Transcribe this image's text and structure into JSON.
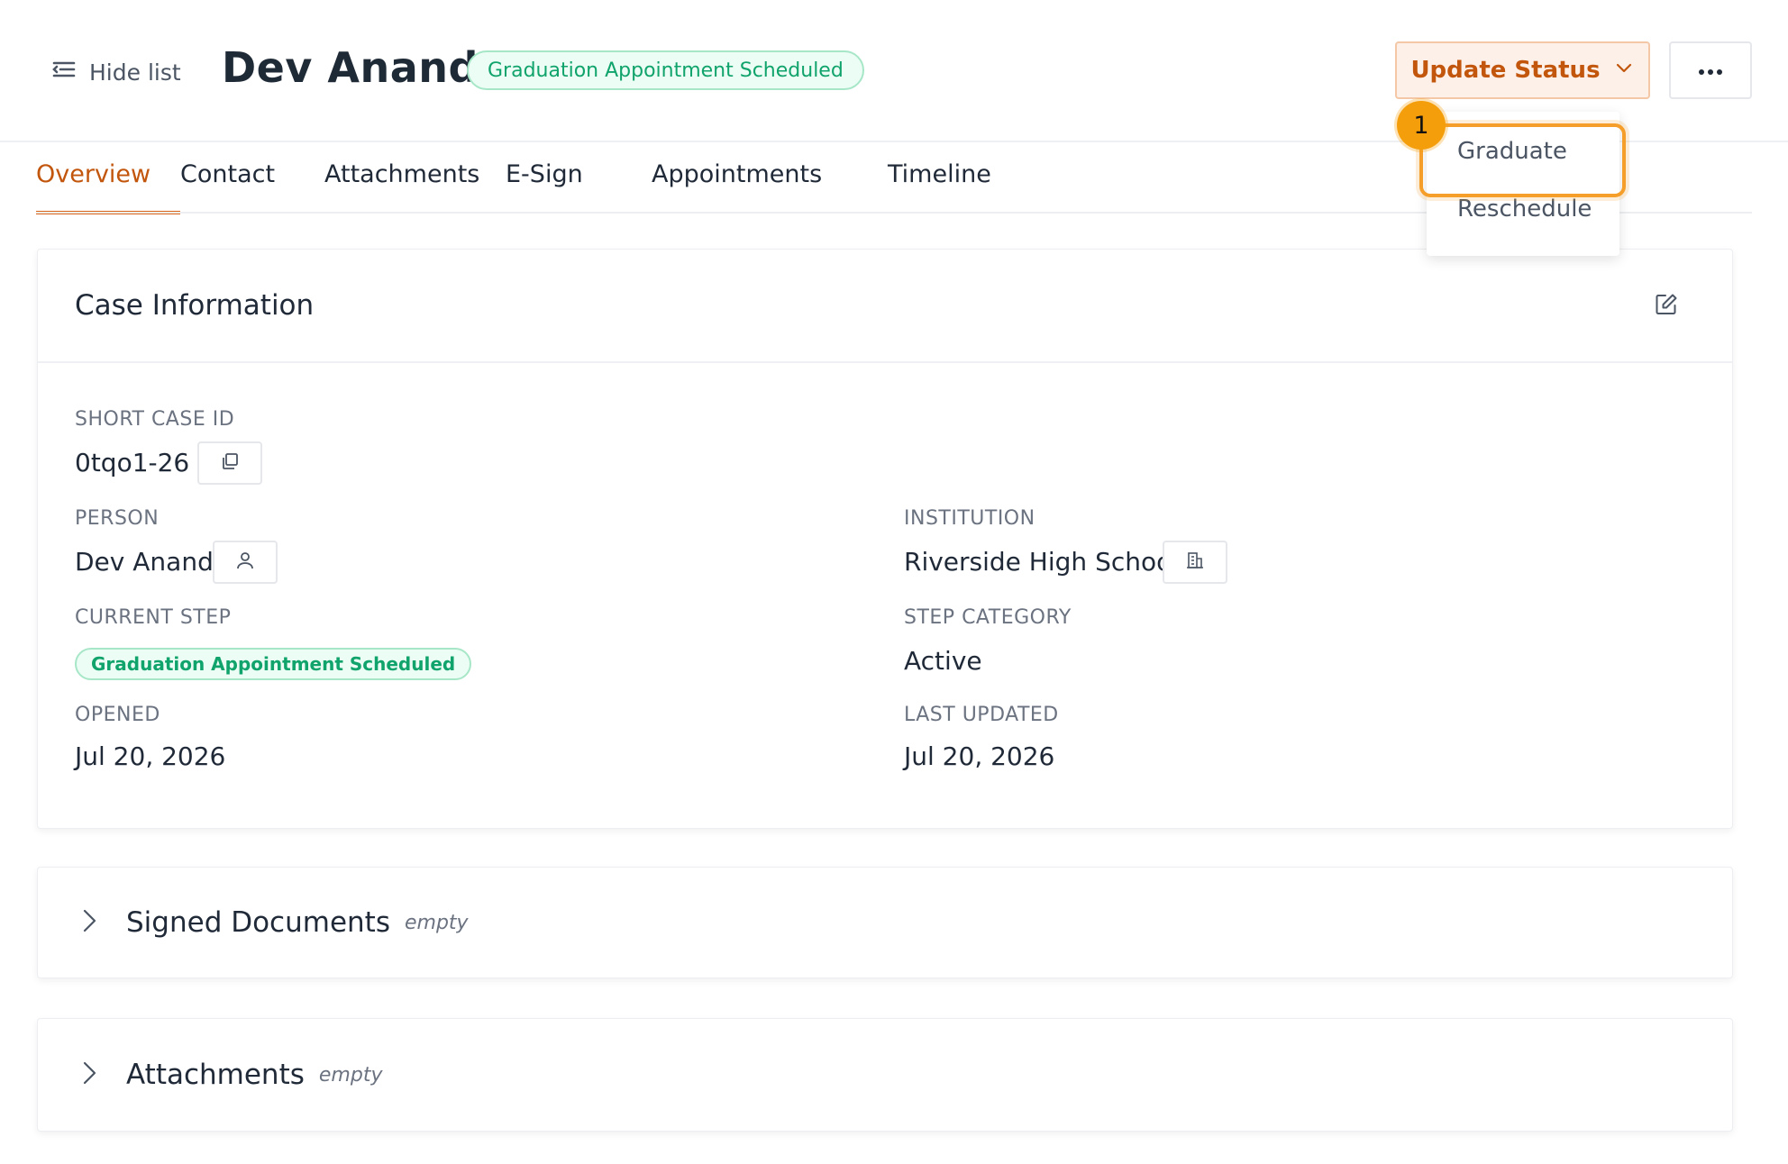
{
  "header": {
    "hide_list_label": "Hide list",
    "title": "Dev Anand",
    "status": "Graduation Appointment Scheduled",
    "update_status_label": "Update Status",
    "accent_color": "#c2560d",
    "status_color": "#10a36b"
  },
  "tabs": [
    {
      "label": "Overview",
      "active": true
    },
    {
      "label": "Contact"
    },
    {
      "label": "Attachments"
    },
    {
      "label": "E-Sign"
    },
    {
      "label": "Appointments"
    },
    {
      "label": "Timeline"
    }
  ],
  "dropdown": {
    "items": [
      "Graduate",
      "Reschedule"
    ],
    "highlight_marker": "1"
  },
  "case_info": {
    "title": "Case Information",
    "short_case_id_label": "SHORT CASE ID",
    "short_case_id": "0tqo1-26",
    "person_label": "PERSON",
    "person": "Dev Anand",
    "institution_label": "INSTITUTION",
    "institution": "Riverside High School",
    "current_step_label": "CURRENT STEP",
    "current_step": "Graduation Appointment Scheduled",
    "step_category_label": "STEP CATEGORY",
    "step_category": "Active",
    "opened_label": "OPENED",
    "opened": "Jul 20, 2026",
    "last_updated_label": "LAST UPDATED",
    "last_updated": "Jul 20, 2026"
  },
  "sections": [
    {
      "title": "Signed Documents",
      "empty_label": "empty"
    },
    {
      "title": "Attachments",
      "empty_label": "empty"
    }
  ]
}
